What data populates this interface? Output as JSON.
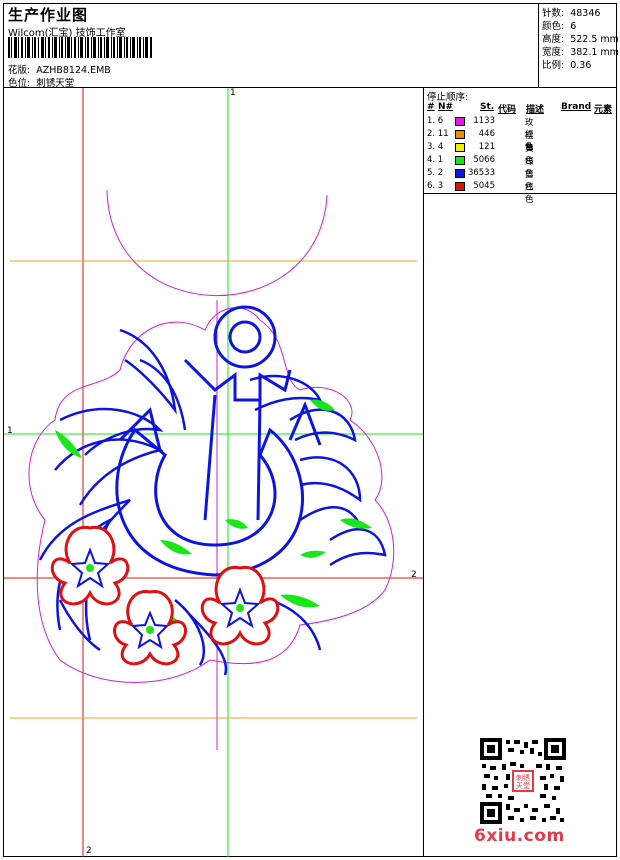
{
  "header": {
    "title": "生产作业图",
    "company": "Wilcom(汇宝) 技饰工作室",
    "design_label": "花版:",
    "design_value": "AZHB8124.EMB",
    "position_label": "色位:",
    "position_value": "刺锈天堂"
  },
  "specs": [
    {
      "label": "针数:",
      "value": "48346"
    },
    {
      "label": "颜色:",
      "value": "6"
    },
    {
      "label": "高度:",
      "value": "522.5 mm"
    },
    {
      "label": "宽度:",
      "value": "382.1 mm"
    },
    {
      "label": "比例:",
      "value": "0.36"
    }
  ],
  "stop_sequence": {
    "title": "停止顺序:",
    "headers": {
      "hash": "#",
      "no": "N#",
      "st": "St.",
      "code": "代码",
      "desc": "描述",
      "brand": "Brand",
      "element": "元素"
    },
    "rows": [
      {
        "seq": "1. 6",
        "color": "#e619e6",
        "stitches": "1133",
        "desc": "玫红色"
      },
      {
        "seq": "2. 11",
        "color": "#f08c00",
        "stitches": "446",
        "desc": "橙色"
      },
      {
        "seq": "3. 4",
        "color": "#f2f200",
        "stitches": "121",
        "desc": "黄色"
      },
      {
        "seq": "4. 1",
        "color": "#19e619",
        "stitches": "5066",
        "desc": "绿色"
      },
      {
        "seq": "5. 2",
        "color": "#0d13e0",
        "stitches": "36533",
        "desc": "蓝色"
      },
      {
        "seq": "6. 3",
        "color": "#e01010",
        "stitches": "5045",
        "desc": "红色"
      }
    ]
  },
  "axis_labels": {
    "top": "1",
    "left": "1",
    "right": "2",
    "bottom": "2"
  },
  "watermark": {
    "text": "6xiu.com",
    "seal_text": "刺绣天堂"
  },
  "colors": {
    "guide_red": "#e01010",
    "guide_green": "#19e619",
    "guide_orange": "#f0a020",
    "guide_magenta": "#d21fd2",
    "outline_blue": "#0d13e0",
    "brand_red": "#e23a4a"
  }
}
